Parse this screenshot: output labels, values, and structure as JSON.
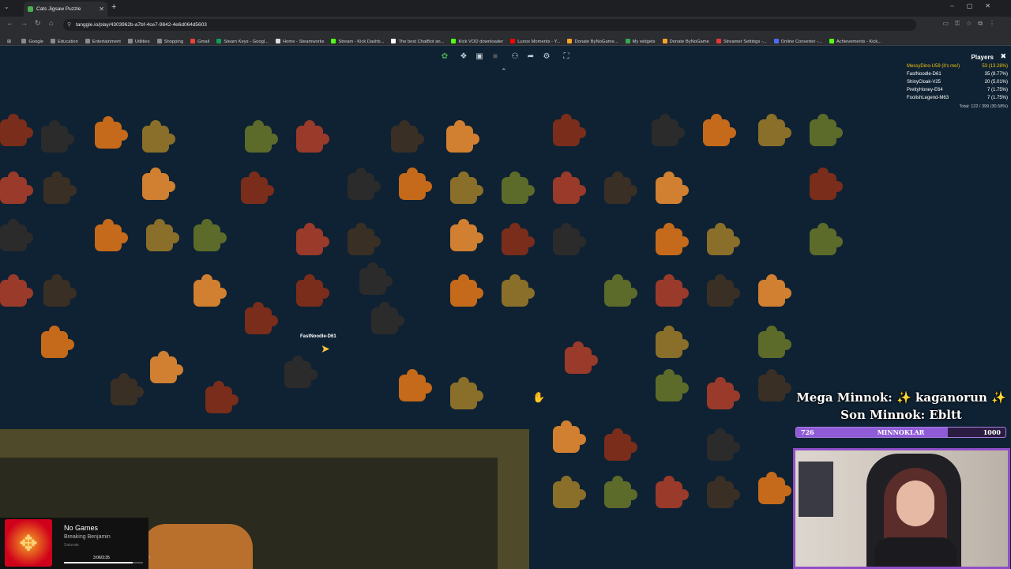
{
  "browser": {
    "tab_title": "Cats Jigsaw Puzzle",
    "url": "tanggle.io/play/4303962b-a7bf-4ce7-9842-4e6d064d5603",
    "bookmarks": [
      {
        "label": "Google",
        "color": "#8a8a8a"
      },
      {
        "label": "Education",
        "color": "#8a8a8a"
      },
      {
        "label": "Entertainment",
        "color": "#8a8a8a"
      },
      {
        "label": "Utilities",
        "color": "#8a8a8a"
      },
      {
        "label": "Shopping",
        "color": "#8a8a8a"
      },
      {
        "label": "Gmail",
        "color": "#ea4335"
      },
      {
        "label": "Steam Keys - Googl...",
        "color": "#0f9d58"
      },
      {
        "label": "Home - Steamworks",
        "color": "#dddddd"
      },
      {
        "label": "Stream - Kick Dashb...",
        "color": "#53fc18"
      },
      {
        "label": "The best ChatBot an...",
        "color": "#ffffff"
      },
      {
        "label": "Kick VOD downloader",
        "color": "#53fc18"
      },
      {
        "label": "Lunox Moments - Y...",
        "color": "#ff0000"
      },
      {
        "label": "Donate ByNoGame...",
        "color": "#f5a623"
      },
      {
        "label": "My widgets",
        "color": "#34a853"
      },
      {
        "label": "Donate ByNoGame",
        "color": "#f5a623"
      },
      {
        "label": "Streamer Settings -...",
        "color": "#e53935"
      },
      {
        "label": "Online Converter -...",
        "color": "#4a6cf7"
      },
      {
        "label": "Achievements - Kick...",
        "color": "#53fc18"
      }
    ]
  },
  "players": {
    "title": "Players",
    "list": [
      {
        "name": "MessyDino-U59 (it's me!)",
        "score": "53 (13.28%)",
        "me": true
      },
      {
        "name": "FastNoodle-D61",
        "score": "35 (8.77%)",
        "me": false
      },
      {
        "name": "ShinyCloak-V25",
        "score": "20 (5.01%)",
        "me": false
      },
      {
        "name": "PrettyHoney-E64",
        "score": "7 (1.75%)",
        "me": false
      },
      {
        "name": "FoolishLegend-M63",
        "score": "7 (1.75%)",
        "me": false
      }
    ],
    "total": "Total: 122 / 399 (30.58%)"
  },
  "cursor_label": "FastNoodle-D61",
  "overlay": {
    "mega": "Mega Minnok: ✨ kaganorun ✨",
    "son": "Son Minnok: Ebltt",
    "bar_label": "MINNOKLAR",
    "bar_value": "726",
    "bar_max": "1000",
    "bar_fraction": 0.726,
    "bar_color": "#8f5bd6"
  },
  "now_playing": {
    "title": "No Games",
    "artist": "Breaking Benjamin",
    "album": "Saturate",
    "time": "3:06/3:35",
    "progress": 0.865
  },
  "piece_colors": [
    "#7a2d1a",
    "#2b2b2b",
    "#c56a1a",
    "#8a6f2a",
    "#5c6b2a",
    "#9a3a2a",
    "#3a2f25",
    "#d08030"
  ]
}
